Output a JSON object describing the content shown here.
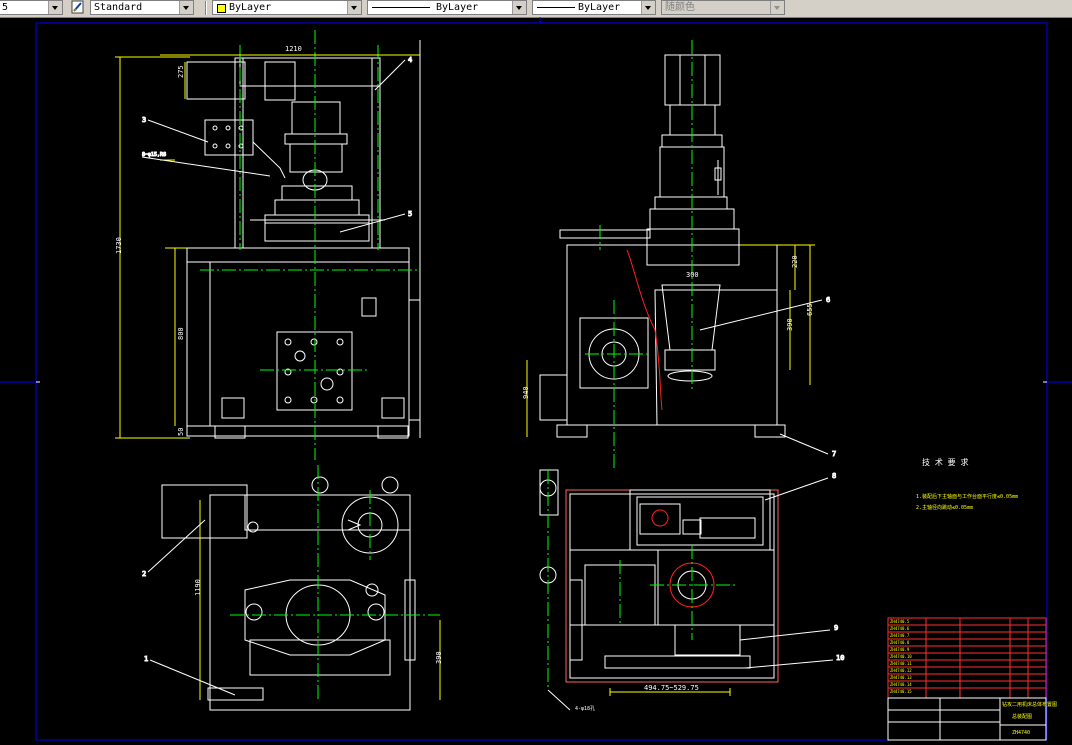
{
  "toolbar": {
    "text_style": {
      "partial_value": "5",
      "value": "Standard"
    },
    "layer": {
      "value": "ByLayer",
      "color": "#ffff00"
    },
    "linetype": {
      "value": "ByLayer"
    },
    "lineweight": {
      "value": "ByLayer"
    },
    "plotstyle": {
      "value": "随颜色"
    }
  },
  "drawing": {
    "background": "#000000",
    "line_color": "#ffffff",
    "centerline_color": "#00ff00",
    "dimension_color": "#ffff00",
    "frame_color": "#0000ff",
    "dimensions": {
      "top_width": "1210",
      "motor_height": "275",
      "total_height": "1730",
      "cabinet_height": "800",
      "base_height": "50",
      "plan_height": "1190",
      "plan_offset": "390",
      "side_upper": "220",
      "side_total": "655",
      "side_mid": "390",
      "side_cabinet": "940",
      "bottom_range": "494.75~529.75",
      "cone_dim": "300",
      "hole_note": "4-φ18孔",
      "hole_note2": "8~φ15,R8"
    },
    "balloons": [
      "1",
      "2",
      "3",
      "4",
      "5",
      "6",
      "7",
      "8",
      "9",
      "10"
    ],
    "tech_requirements": {
      "title": "技 术 要 求",
      "line1": "1.装配后下主轴面与工作台面平行度≤0.05mm",
      "line2": "2.主轴径向跳动≤0.05mm"
    },
    "title_block": {
      "rows": [
        "ZH4740.5",
        "ZH4740.6",
        "ZH4740.7",
        "ZH4740.8",
        "ZH4740.9",
        "ZH4740.10",
        "ZH4740.11",
        "ZH4740.12",
        "ZH4740.13",
        "ZH4740.14",
        "ZH4740.15"
      ],
      "drawing_name": "钻攻二用机床总体布置图",
      "drawing_no": "ZH4740",
      "scale_label": "总装配图"
    }
  }
}
